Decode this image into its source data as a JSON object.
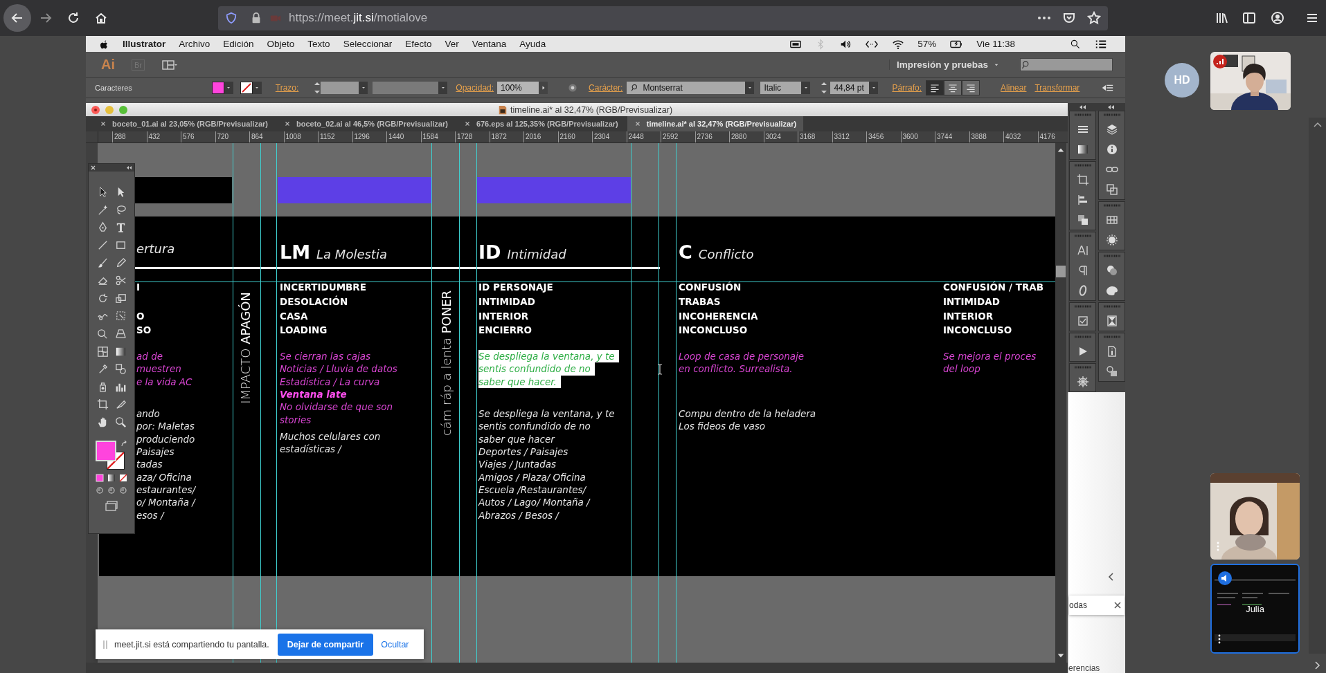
{
  "browser": {
    "url": "https://meet.**jit.si**/motialove"
  },
  "menu_bar": {
    "app": "Illustrator",
    "items": [
      "Archivo",
      "Edición",
      "Objeto",
      "Texto",
      "Seleccionar",
      "Efecto",
      "Ver",
      "Ventana",
      "Ayuda"
    ],
    "battery": "57%",
    "clock": "Vie 11:38"
  },
  "app_bar": {
    "logo": "Ai",
    "bridge": "Br",
    "workspace": "Impresión y pruebas"
  },
  "control_bar": {
    "panel": "Caracteres",
    "stroke_label": "Trazo:",
    "opacity_label": "Opacidad:",
    "opacity": "100%",
    "character_label": "Carácter:",
    "font": "Montserrat",
    "font_style": "Italic",
    "font_size": "44,84 pt",
    "paragraph_label": "Párrafo:",
    "paragraph_align": [
      {
        "kind": "left",
        "selected": true
      },
      {
        "kind": "center",
        "selected": false
      },
      {
        "kind": "right",
        "selected": false
      }
    ],
    "links": [
      "Alinear",
      "Transformar"
    ]
  },
  "document": {
    "title": "timeline.ai* al 32,47% (RGB/Previsualizar)",
    "tabs": [
      {
        "label": "boceto_01.ai al 23,05% (RGB/Previsualizar)",
        "selected": false
      },
      {
        "label": "boceto_02.ai al 46,5% (RGB/Previsualizar)",
        "selected": false
      },
      {
        "label": "676.eps al 125,35% (RGB/Previsualizar)",
        "selected": false
      },
      {
        "label": "timeline.ai* al 32,47% (RGB/Previsualizar)",
        "selected": true
      }
    ],
    "ruler": [
      "288",
      "432",
      "576",
      "720",
      "864",
      "1008",
      "1152",
      "1296",
      "1440",
      "1584",
      "1728",
      "1872",
      "2016",
      "2160",
      "2304",
      "2448",
      "2592",
      "2736",
      "2880",
      "3024",
      "3168",
      "3312",
      "3456",
      "3600",
      "3744",
      "3888",
      "4032",
      "4176"
    ]
  },
  "artboard": {
    "vertical_labels": [
      "IMPACTO **APAGÓN**",
      "cám ráp a lenta **PONER**"
    ],
    "columns": [
      {
        "title": "ertura",
        "keywords": [
          "I",
          "O",
          "SO"
        ],
        "notes": [
          {
            "kind": "note",
            "lines": [
              "ad de",
              "muestren",
              "e la vida AC"
            ]
          },
          {
            "kind": "body",
            "lines": [
              "ando",
              "por: Maletas",
              "produciendo",
              "Paisajes",
              "tadas",
              "aza/ Oficina",
              "estaurantes/",
              "o/ Montaña /",
              "esos /"
            ]
          }
        ]
      },
      {
        "code": "LM",
        "title": "La Molestia",
        "keywords": [
          "INCERTIDUMBRE",
          "DESOLACIÓN",
          "CASA",
          "LOADING"
        ],
        "notes": [
          {
            "kind": "note",
            "lines": [
              "Se cierran las cajas",
              "Noticias / Lluvia de datos",
              "Estadística / La curva"
            ]
          },
          {
            "kind": "emphasis",
            "lines": [
              "Ventana late"
            ]
          },
          {
            "kind": "note",
            "lines": [
              "No olvidarse de que son",
              "stories"
            ]
          },
          {
            "kind": "body",
            "lines": [
              "Muchos celulares con",
              "estadísticas  /"
            ]
          }
        ]
      },
      {
        "code": "ID",
        "title": "Intimidad",
        "keywords": [
          "ID PERSONAJE",
          "INTIMIDAD",
          "INTERIOR",
          "ENCIERRO"
        ],
        "notes": [
          {
            "kind": "selected",
            "lines": [
              "Se despliega la ventana, y te",
              "sentis confundido de no",
              "saber que hacer."
            ]
          },
          {
            "kind": "body",
            "lines": [
              "Se despliega la ventana, y te",
              "sentis confundido de no",
              "saber que hacer",
              "Deportes / Paisajes",
              "Viajes / Juntadas",
              "Amigos / Plaza/ Oficina",
              "Escuela /Restaurantes/",
              "Autos / Lago/ Montaña /",
              "Abrazos / Besos /"
            ]
          }
        ]
      },
      {
        "code": "C",
        "title": "Conflicto",
        "keywords": [
          "CONFUSIÓN",
          "TRABAS",
          "INCOHERENCIA",
          "INCONCLUSO"
        ],
        "notes": [
          {
            "kind": "note",
            "lines": [
              "Loop de casa de personaje",
              "en conflicto. Surrealista."
            ]
          },
          {
            "kind": "body",
            "lines": [
              "Compu dentro de la heladera",
              "Los fideos de vaso"
            ]
          }
        ]
      },
      {
        "keywords": [
          "CONFUSIÓN / TRAB",
          "INTIMIDAD",
          "INTERIOR",
          "INCONCLUSO"
        ],
        "notes": [
          {
            "kind": "note",
            "lines": [
              "Se mejora el proces",
              "del loop"
            ]
          }
        ]
      }
    ]
  },
  "side_panel": {
    "row_label": "odas",
    "footer": "erencias"
  },
  "jitsi": {
    "avatar": "HD",
    "screen_tile": {
      "name": "Julia",
      "dominant": true
    }
  },
  "share_notice": {
    "text": "meet.jit.si está compartiendo tu pantalla.",
    "stop": "Dejar de compartir",
    "hide": "Ocultar"
  }
}
